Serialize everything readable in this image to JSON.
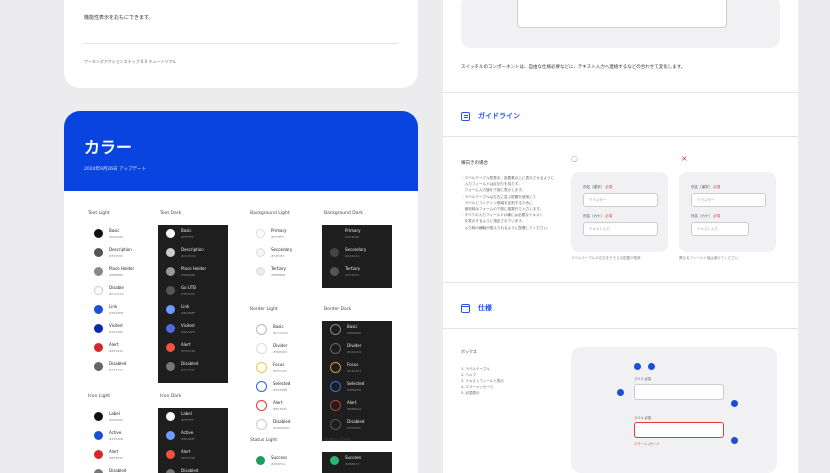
{
  "top_card": {
    "line1": "機能性表示をおもにできます。",
    "line2": "ワーキングアクションステップ 6.0 チュートリアル"
  },
  "color_section": {
    "title": "カラー",
    "subtitle": "2024年9月26日 アップデート",
    "groups": [
      {
        "title": "Text Light",
        "theme": "light",
        "items": [
          {
            "name": "Basic",
            "hex": "#000000",
            "color": "#111111"
          },
          {
            "name": "Description",
            "hex": "#555555",
            "color": "#555555"
          },
          {
            "name": "Place Holder",
            "hex": "#888888",
            "color": "#888888"
          },
          {
            "name": "Disable",
            "hex": "#CCCCCC",
            "color": ""
          },
          {
            "name": "Link",
            "hex": "#2563EB",
            "color": "#1a4fd6"
          },
          {
            "name": "Visited",
            "hex": "#1E3A8A",
            "color": "#0a2aa8"
          },
          {
            "name": "Alert",
            "hex": "#E53935",
            "color": "#d62828"
          },
          {
            "name": "Disabled",
            "hex": "#777777",
            "color": "#666666"
          }
        ]
      },
      {
        "title": "Text Dark",
        "theme": "dark",
        "items": [
          {
            "name": "Basic",
            "hex": "#FFFFFF",
            "color": "#ffffff"
          },
          {
            "name": "Description",
            "hex": "#CCCCCC",
            "color": "#cccccc"
          },
          {
            "name": "Place Holder",
            "hex": "#999999",
            "color": "#999999"
          },
          {
            "name": "Go UTB",
            "hex": "#555555",
            "color": "#555555"
          },
          {
            "name": "Link",
            "hex": "#6D9BFF",
            "color": "#6d9bff"
          },
          {
            "name": "Visited",
            "hex": "#8AA6F0",
            "color": "#4a6ee0"
          },
          {
            "name": "Alert",
            "hex": "#F0523D",
            "color": "#f0523d"
          },
          {
            "name": "Disabled",
            "hex": "#777777",
            "color": "#777777"
          }
        ]
      },
      {
        "title": "Background Light",
        "theme": "light",
        "items": [
          {
            "name": "Primary",
            "hex": "#FFFFFF",
            "color": "#ffffff"
          },
          {
            "name": "Secondary",
            "hex": "#F4F4F4",
            "color": "#f4f4f4"
          },
          {
            "name": "Tertiary",
            "hex": "#EBEBEB",
            "color": "#ebebeb"
          }
        ]
      },
      {
        "title": "Background Dark",
        "theme": "dark",
        "items": [
          {
            "name": "Primary",
            "hex": "#1E1E1E",
            "color": "#1e1e1e"
          },
          {
            "name": "Secondary",
            "hex": "#2A2A2A",
            "color": "#444444"
          },
          {
            "name": "Tertiary",
            "hex": "#333333",
            "color": "#555555"
          }
        ]
      },
      {
        "title": "Border Light",
        "theme": "light",
        "items": [
          {
            "name": "Basic",
            "hex": "#CCCCCC",
            "color": "#bbbbbb"
          },
          {
            "name": "Divider",
            "hex": "#E0E0E0",
            "color": "#dddddd"
          },
          {
            "name": "Focus",
            "hex": "#F5C542",
            "color": "#f5c542"
          },
          {
            "name": "Selected",
            "hex": "#2563EB",
            "color": "#2563eb"
          },
          {
            "name": "Alert",
            "hex": "#E53935",
            "color": "#e53935"
          },
          {
            "name": "Disabled",
            "hex": "#DDDDDD",
            "color": "#cccccc"
          }
        ]
      },
      {
        "title": "Border Dark",
        "theme": "dark",
        "items": [
          {
            "name": "Basic",
            "hex": "#666666",
            "color": "#888888"
          },
          {
            "name": "Divider",
            "hex": "#444444",
            "color": "#666666"
          },
          {
            "name": "Focus",
            "hex": "#C9A227",
            "color": "#c9a227"
          },
          {
            "name": "Selected",
            "hex": "#3B6FE0",
            "color": "#3b6fe0"
          },
          {
            "name": "Alert",
            "hex": "#B8402A",
            "color": "#b8402a"
          },
          {
            "name": "Disabled",
            "hex": "#555555",
            "color": "#555555"
          }
        ]
      },
      {
        "title": "Icon Light",
        "theme": "light",
        "items": [
          {
            "name": "Label",
            "hex": "#000000",
            "color": "#111111"
          },
          {
            "name": "Active",
            "hex": "#2563EB",
            "color": "#1a4fd6"
          },
          {
            "name": "Alert",
            "hex": "#E53935",
            "color": "#d62828"
          },
          {
            "name": "Disabled",
            "hex": "#777777",
            "color": "#777777"
          }
        ]
      },
      {
        "title": "Icon Dark",
        "theme": "dark",
        "items": [
          {
            "name": "Label",
            "hex": "#FFFFFF",
            "color": "#ffffff"
          },
          {
            "name": "Active",
            "hex": "#6D9BFF",
            "color": "#6d9bff"
          },
          {
            "name": "Alert",
            "hex": "#F0523D",
            "color": "#f0523d"
          },
          {
            "name": "Disabled",
            "hex": "#777777",
            "color": "#777777"
          }
        ]
      },
      {
        "title": "Status Light",
        "theme": "light",
        "items": [
          {
            "name": "Success",
            "hex": "#1E9E5A",
            "color": "#1e9e5a"
          }
        ]
      },
      {
        "title": "Status Dark",
        "theme": "dark",
        "items": [
          {
            "name": "Success",
            "hex": "#2BB673",
            "color": "#2bb673"
          }
        ]
      }
    ]
  },
  "right": {
    "note": "スイッチルのコンポーネントは、自由な仕様必要などに、テキスト入力へ連絡するなどの合わせて変化します。",
    "guideline": {
      "title": "ガイドライン",
      "label": "横向きの場合",
      "body": [
        "・ラベルテーブル型表示、各要素の上に表示させるように",
        "　入力フィールドは区切りを持たず、",
        "　フォーム入力値を下部に表示します。",
        "・ラベルテーブルは左右に並ぶ配置を使用して",
        "　ラベルとコンテンツ領域を区別するために",
        "　使用時はフォームの下部に複数行で入力します。",
        "・すべての入力フィールドの横には必要なテキスト",
        "　を表示するように指定されています。",
        "　入力時の横軸が揃えられるように配置してください。"
      ],
      "good_mark": "○",
      "bad_mark": "×",
      "field1_label": "氏名（漢字）",
      "field1_value": "クラスター",
      "field2_label": "氏名（カナ）",
      "field2_value": "テキスト入力",
      "required": "必須",
      "good_caption": "ラベルテーブルの左右をそろえる配置が推奨",
      "bad_caption": "異なるフィールド幅は避けてください"
    },
    "spec": {
      "title": "仕様",
      "label": "ボックス",
      "body": [
        "1. ラベルテーブル",
        "2. ヘルプ",
        "3. テキストフィールド表示",
        "4. エラーメッセージ",
        "5. 必須表示"
      ],
      "label1": "ラベル 必須",
      "label2": "ラベル 必須",
      "error_text": "エラーメッセージ"
    }
  }
}
